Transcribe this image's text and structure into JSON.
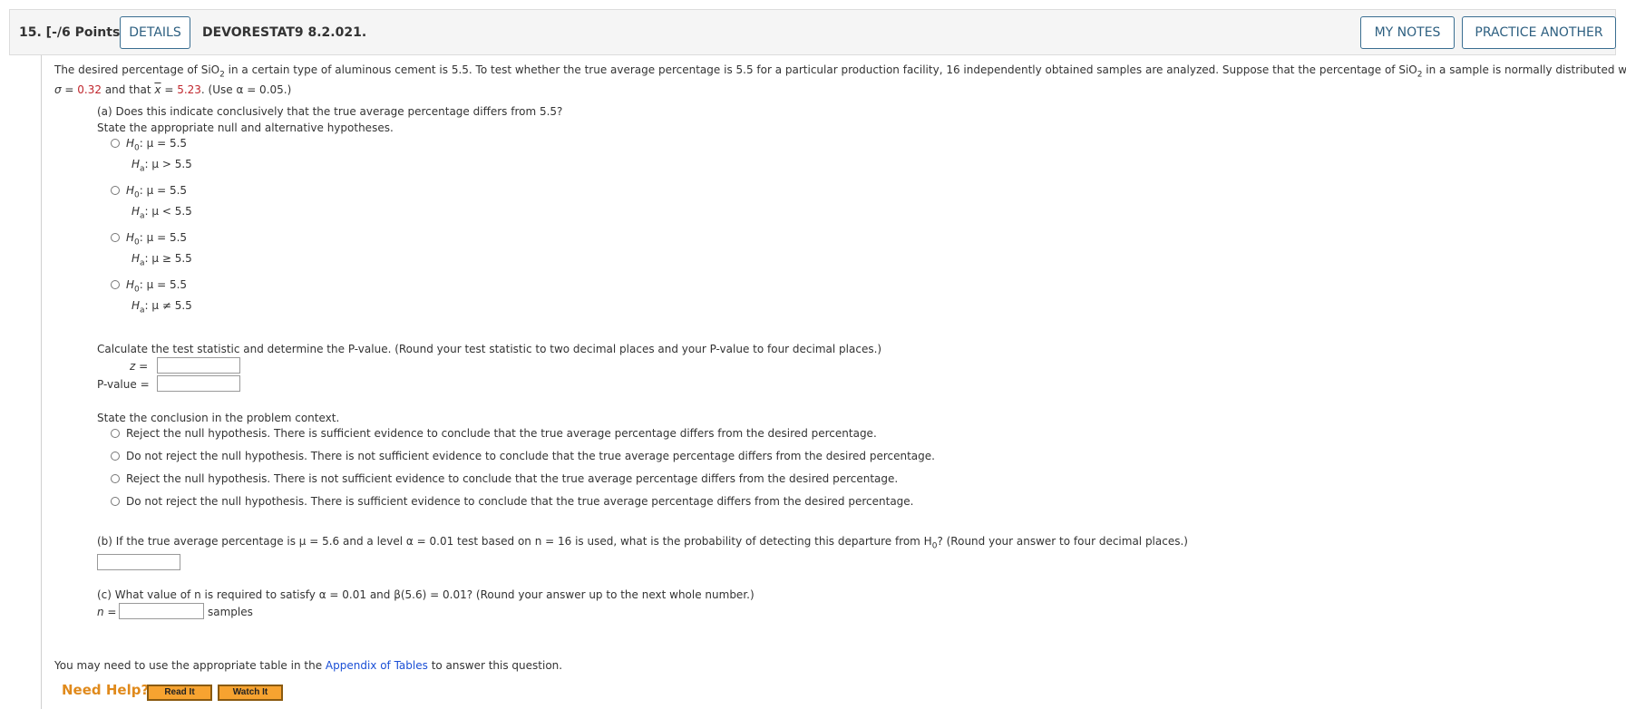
{
  "header": {
    "question_number": "15.  [-/6 Points]",
    "details_button": "DETAILS",
    "assignment_code": "DEVORESTAT9 8.2.021.",
    "my_notes_button": "MY NOTES",
    "practice_button": "PRACTICE ANOTHER"
  },
  "intro": {
    "text1": "The desired percentage of SiO",
    "text1_sub": "2",
    "text2": " in a certain type of aluminous cement is 5.5. To test whether the true average percentage is 5.5 for a particular production facility, 16 independently obtained samples are analyzed. Suppose that the percentage of SiO",
    "text2_sub": "2",
    "text3": " in a sample is normally distributed with",
    "sigma_symbol": "σ",
    "eq": " = ",
    "sigma_value": "0.32",
    "and_that": " and that ",
    "xbar": "x",
    "xbar_eq": " = ",
    "xbar_value": "5.23",
    "use_alpha": ". (Use α = 0.05.)"
  },
  "part_a": {
    "question": "(a) Does this indicate conclusively that the true average percentage differs from 5.5?",
    "hypotheses_prompt": "State the appropriate null and alternative hypotheses.",
    "options": [
      {
        "h0": ": μ = 5.5",
        "ha": ": μ > 5.5"
      },
      {
        "h0": ": μ = 5.5",
        "ha": ": μ < 5.5"
      },
      {
        "h0": ": μ = 5.5",
        "ha": ": μ ≥ 5.5"
      },
      {
        "h0": ": μ = 5.5",
        "ha": ": μ ≠ 5.5"
      }
    ],
    "h_letter": "H",
    "h0_sub": "0",
    "ha_sub": "a",
    "calc_prompt": "Calculate the test statistic and determine the P-value. (Round your test statistic to two decimal places and your P-value to four decimal places.)",
    "z_label": "z =",
    "pvalue_label": "P-value =",
    "z_value": "",
    "pvalue_value": "",
    "conclusion_prompt": "State the conclusion in the problem context.",
    "conclusions": [
      "Reject the null hypothesis. There is sufficient evidence to conclude that the true average percentage differs from the desired percentage.",
      "Do not reject the null hypothesis. There is not sufficient evidence to conclude that the true average percentage differs from the desired percentage.",
      "Reject the null hypothesis. There is not sufficient evidence to conclude that the true average percentage differs from the desired percentage.",
      "Do not reject the null hypothesis. There is sufficient evidence to conclude that the true average percentage differs from the desired percentage."
    ]
  },
  "part_b": {
    "question_pre": "(b) If the true average percentage is μ = 5.6 and a level α = 0.01 test based on n = 16 is used, what is the probability of detecting this departure from H",
    "question_sub": "0",
    "question_post": "? (Round your answer to four decimal places.)",
    "answer_value": ""
  },
  "part_c": {
    "question": "(c) What value of n is required to satisfy α = 0.01 and β(5.6) = 0.01? (Round your answer up to the next whole number.)",
    "n_label": "n =",
    "n_value": "",
    "samples_label": "samples"
  },
  "footer": {
    "appendix_pre": "You may need to use the appropriate table in the ",
    "appendix_link": "Appendix of Tables",
    "appendix_post": " to answer this question.",
    "need_help": "Need Help?",
    "read_it": "Read It",
    "watch_it": "Watch It"
  },
  "colors": {
    "accent_blue": "#2d5f80",
    "value_red": "#c0262d",
    "link_blue": "#1a4fd6",
    "help_orange": "#e08a1c"
  }
}
